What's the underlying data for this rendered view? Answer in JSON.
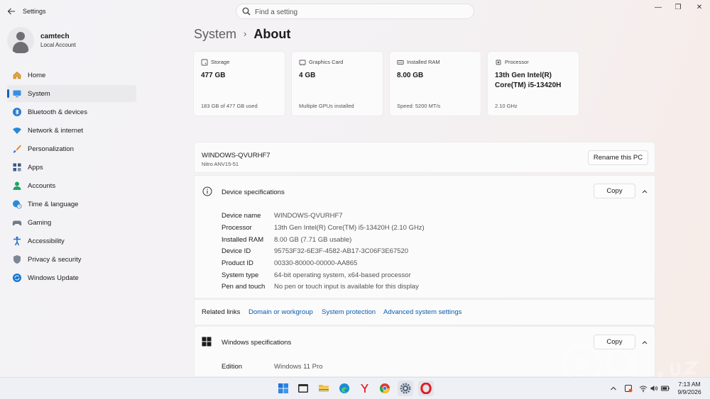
{
  "window": {
    "app_title": "Settings",
    "minimize": "—",
    "maximize": "❐",
    "close": "✕"
  },
  "search": {
    "placeholder": "Find a setting"
  },
  "user": {
    "name": "camtech",
    "account_type": "Local Account"
  },
  "nav": [
    {
      "label": "Home",
      "icon": "home-icon",
      "active": false
    },
    {
      "label": "System",
      "icon": "system-icon",
      "active": true
    },
    {
      "label": "Bluetooth & devices",
      "icon": "bluetooth-icon",
      "active": false
    },
    {
      "label": "Network & internet",
      "icon": "network-icon",
      "active": false
    },
    {
      "label": "Personalization",
      "icon": "brush-icon",
      "active": false
    },
    {
      "label": "Apps",
      "icon": "apps-icon",
      "active": false
    },
    {
      "label": "Accounts",
      "icon": "accounts-icon",
      "active": false
    },
    {
      "label": "Time & language",
      "icon": "globe-clock-icon",
      "active": false
    },
    {
      "label": "Gaming",
      "icon": "gamepad-icon",
      "active": false
    },
    {
      "label": "Accessibility",
      "icon": "accessibility-icon",
      "active": false
    },
    {
      "label": "Privacy & security",
      "icon": "shield-icon",
      "active": false
    },
    {
      "label": "Windows Update",
      "icon": "update-icon",
      "active": false
    }
  ],
  "breadcrumb": {
    "parent": "System",
    "separator": "›",
    "current": "About"
  },
  "cards": [
    {
      "label": "Storage",
      "value": "477 GB",
      "sub": "183 GB of 477 GB used",
      "icon": "storage-icon"
    },
    {
      "label": "Graphics Card",
      "value": "4 GB",
      "sub": "Multiple GPUs installed",
      "icon": "gpu-icon"
    },
    {
      "label": "Installed RAM",
      "value": "8.00 GB",
      "sub": "Speed: 5200 MT/s",
      "icon": "ram-icon"
    },
    {
      "label": "Processor",
      "value": "13th Gen Intel(R) Core(TM) i5-13420H",
      "sub": "2.10 GHz",
      "icon": "cpu-icon"
    }
  ],
  "device": {
    "name": "WINDOWS-QVURHF7",
    "model": "Nitro ANV15-51",
    "rename_label": "Rename this PC"
  },
  "device_specs": {
    "title": "Device specifications",
    "copy_label": "Copy",
    "rows": [
      {
        "key": "Device name",
        "value": "WINDOWS-QVURHF7"
      },
      {
        "key": "Processor",
        "value": "13th Gen Intel(R) Core(TM) i5-13420H (2.10 GHz)"
      },
      {
        "key": "Installed RAM",
        "value": "8.00 GB (7.71 GB usable)"
      },
      {
        "key": "Device ID",
        "value": "95753F32-6E3F-4582-AB17-3C06F3E67520"
      },
      {
        "key": "Product ID",
        "value": "00330-80000-00000-AA865"
      },
      {
        "key": "System type",
        "value": "64-bit operating system, x64-based processor"
      },
      {
        "key": "Pen and touch",
        "value": "No pen or touch input is available for this display"
      }
    ]
  },
  "related_links": {
    "label": "Related links",
    "links": [
      "Domain or workgroup",
      "System protection",
      "Advanced system settings"
    ]
  },
  "windows_specs": {
    "title": "Windows specifications",
    "copy_label": "Copy",
    "rows": [
      {
        "key": "Edition",
        "value": "Windows 11 Pro"
      }
    ]
  },
  "taskbar": {
    "apps": [
      "start-icon",
      "terminal-icon",
      "file-explorer-icon",
      "edge-icon",
      "yandex-icon",
      "chrome-icon",
      "settings-icon",
      "opera-icon"
    ],
    "time": "7:13 AM",
    "date": "9/9/2026"
  },
  "colors": {
    "accent": "#0067c0",
    "link": "#0b5cad",
    "opera_red": "#e21b23"
  }
}
